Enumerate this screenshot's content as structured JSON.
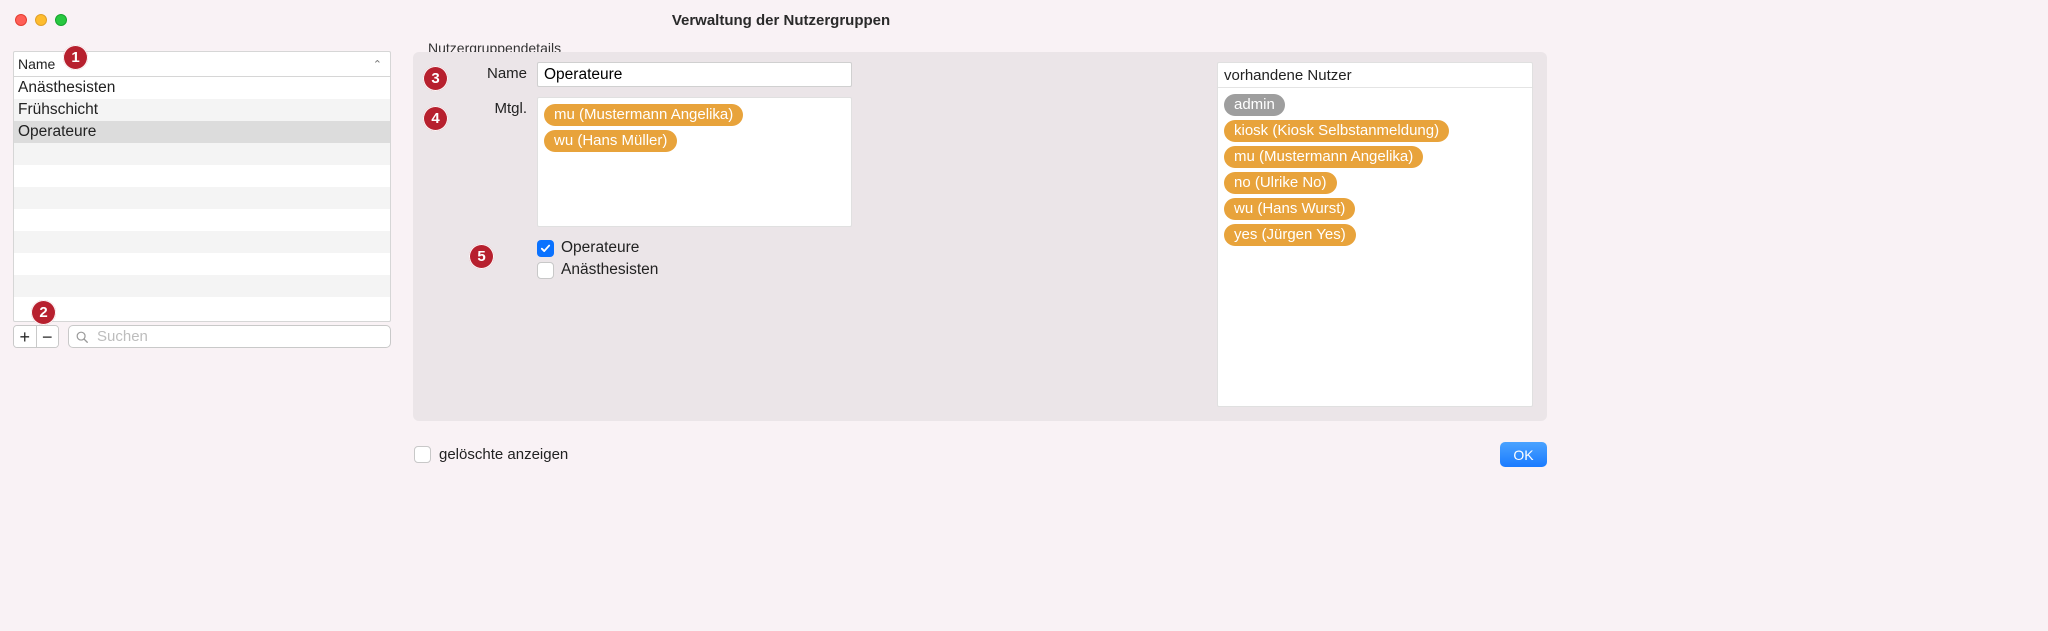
{
  "window": {
    "title": "Verwaltung der Nutzergruppen"
  },
  "list": {
    "header": "Name",
    "items": [
      "Anästhesisten",
      "Frühschicht",
      "Operateure"
    ],
    "selected_index": 2,
    "search_placeholder": "Suchen"
  },
  "details": {
    "section_title": "Nutzergruppendetails",
    "name_label": "Name",
    "name_value": "Operateure",
    "members_label": "Mtgl.",
    "members": [
      "mu (Mustermann Angelika)",
      "wu (Hans Müller)"
    ],
    "checkboxes": [
      {
        "label": "Operateure",
        "checked": true
      },
      {
        "label": "Anästhesisten",
        "checked": false
      }
    ],
    "available_header": "vorhandene Nutzer",
    "available": [
      {
        "label": "admin",
        "type": "gray"
      },
      {
        "label": "kiosk (Kiosk Selbstanmeldung)",
        "type": "orange"
      },
      {
        "label": "mu (Mustermann Angelika)",
        "type": "orange"
      },
      {
        "label": "no (Ulrike No)",
        "type": "orange"
      },
      {
        "label": "wu (Hans Wurst)",
        "type": "orange"
      },
      {
        "label": "yes (Jürgen Yes)",
        "type": "orange"
      }
    ]
  },
  "footer": {
    "show_deleted_label": "gelöschte anzeigen",
    "show_deleted_checked": false,
    "ok": "OK"
  },
  "annotations": [
    "1",
    "2",
    "3",
    "4",
    "5"
  ]
}
